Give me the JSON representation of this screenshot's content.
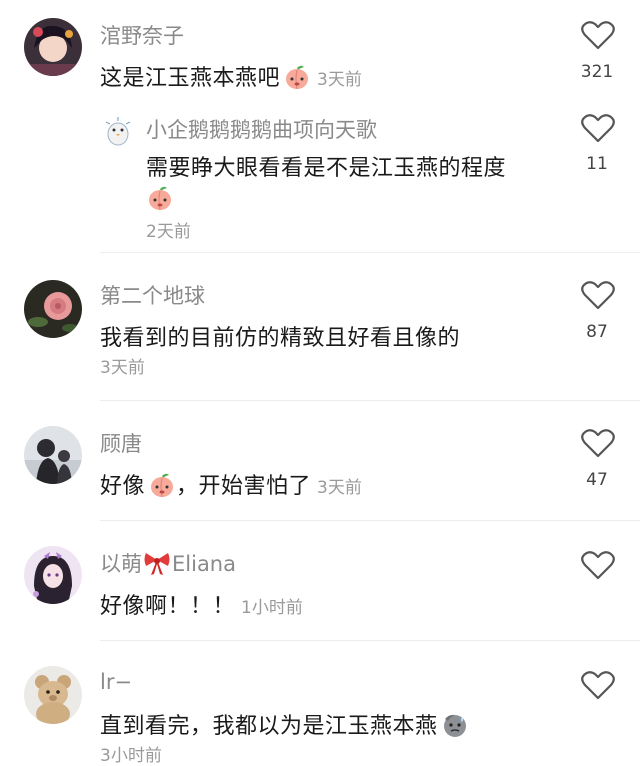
{
  "comments": [
    {
      "username": "涫野奈子",
      "text": "这是江玉燕本燕吧",
      "time": "3天前",
      "likes": "321",
      "reply": {
        "username": "小企鹅鹅鹅鹅曲项向天歌",
        "text": "需要睁大眼看看是不是江玉燕的程度",
        "time": "2天前",
        "likes": "11"
      }
    },
    {
      "username": "第二个地球",
      "text": "我看到的目前仿的精致且好看且像的",
      "time": "3天前",
      "likes": "87"
    },
    {
      "username": "顾唐",
      "text_before": "好像",
      "text_after": "，开始害怕了",
      "time": "3天前",
      "likes": "47"
    },
    {
      "username_prefix": "以萌",
      "username_suffix": "Eliana",
      "text": "好像啊！！！",
      "time": "1小时前",
      "likes": ""
    },
    {
      "username": "lr−",
      "text": "直到看完，我都以为是江玉燕本燕",
      "time": "3小时前",
      "likes": ""
    }
  ],
  "icons": {
    "heart": "heart-outline-icon",
    "peach_emoji": "peach-emoji-icon",
    "sweat_emoji": "sweat-emoji-icon",
    "bow_emoji": "red-bow-icon"
  }
}
